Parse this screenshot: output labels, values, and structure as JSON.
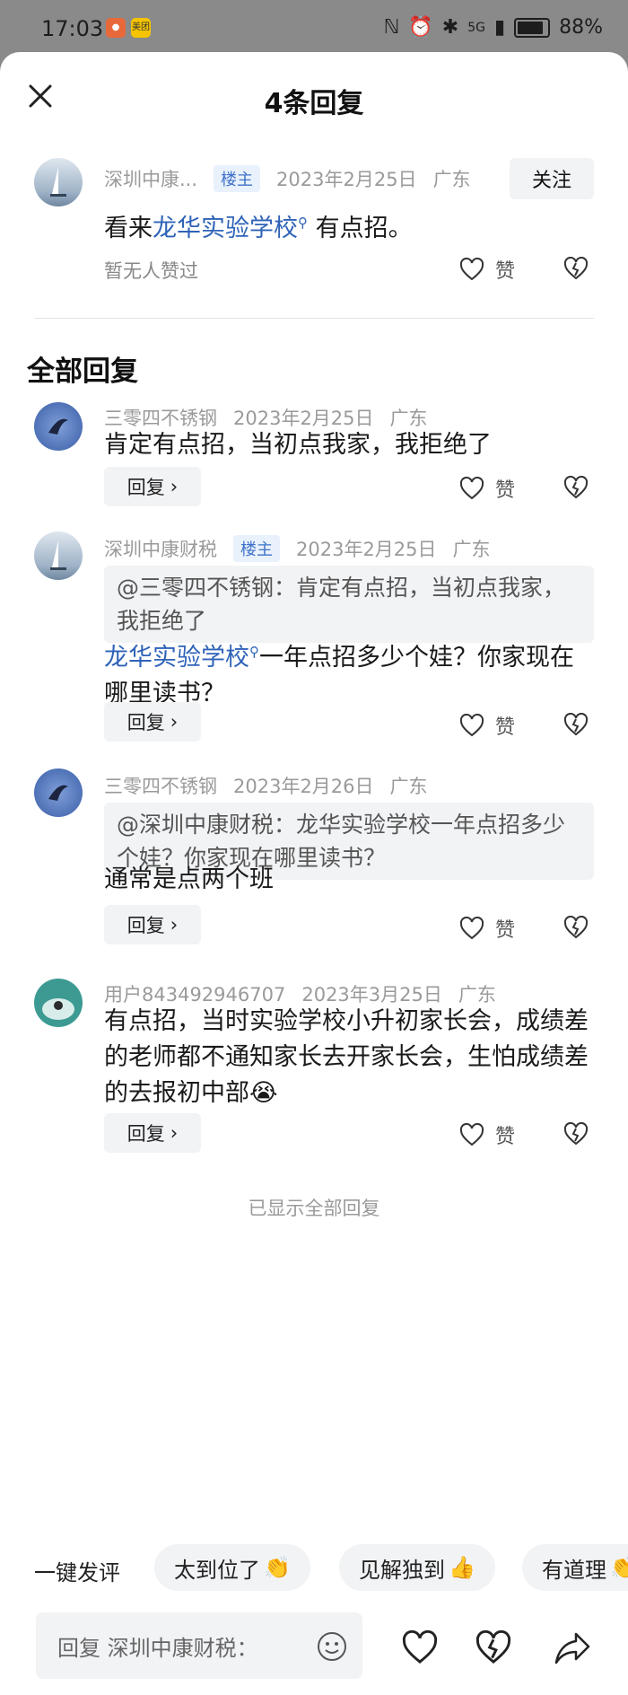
{
  "status_bar": {
    "time": "17:03",
    "app_icon_1": "美团",
    "network": "5G",
    "battery": "88%",
    "battery_level": 0.88
  },
  "header": {
    "title": "4条回复",
    "close_icon": "close-icon"
  },
  "main_comment": {
    "author": "深圳中康...",
    "tag": "楼主",
    "date": "2023年2月25日",
    "location": "广东",
    "follow_label": "关注",
    "text_before": "看来",
    "link": "龙华实验学校",
    "text_after": " 有点招。",
    "no_likes": "暂无人赞过",
    "like_label": "赞"
  },
  "section_title": "全部回复",
  "replies": [
    {
      "author": "三零四不锈钢",
      "date": "2023年2月25日",
      "location": "广东",
      "text": "肯定有点招，当初点我家，我拒绝了",
      "reply_label": "回复",
      "like_label": "赞"
    },
    {
      "author": "深圳中康财税",
      "tag": "楼主",
      "date": "2023年2月25日",
      "location": "广东",
      "quote": "@三零四不锈钢：肯定有点招，当初点我家，我拒绝了",
      "link": "龙华实验学校",
      "text": "一年点招多少个娃？你家现在哪里读书？",
      "reply_label": "回复",
      "like_label": "赞"
    },
    {
      "author": "三零四不锈钢",
      "date": "2023年2月26日",
      "location": "广东",
      "quote": "@深圳中康财税：龙华实验学校一年点招多少个娃？你家现在哪里读书？",
      "text": "通常是点两个班",
      "reply_label": "回复",
      "like_label": "赞"
    },
    {
      "author": "用户843492946707",
      "date": "2023年3月25日",
      "location": "广东",
      "text": "有点招，当时实验学校小升初家长会，成绩差的老师都不通知家长去开家长会，生怕成绩差的去报初中部",
      "emoji": "😭",
      "reply_label": "回复",
      "like_label": "赞"
    }
  ],
  "shown_all": "已显示全部回复",
  "quick_comment": {
    "label": "一键发评",
    "chips": [
      {
        "text": "太到位了",
        "emoji": "👏"
      },
      {
        "text": "见解独到",
        "emoji": "👍"
      },
      {
        "text": "有道理",
        "emoji": "👏"
      }
    ]
  },
  "bottom_bar": {
    "reply_placeholder": "回复 深圳中康财税："
  },
  "colors": {
    "link": "#2f63b8",
    "tag_bg": "#e8f1fc",
    "tag_text": "#3f72c8",
    "chip_bg": "#f2f3f5"
  }
}
